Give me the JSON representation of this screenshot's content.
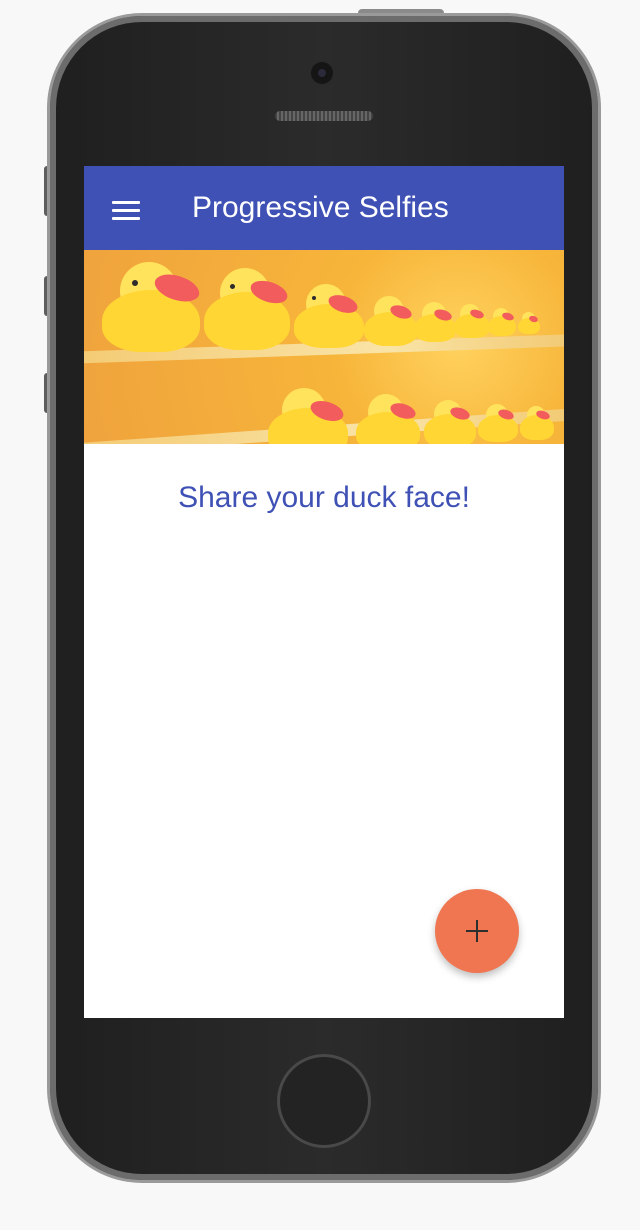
{
  "app": {
    "title": "Progressive Selfies",
    "headline": "Share your duck face!",
    "fab_symbol": "+",
    "colors": {
      "appbar": "#3f51b5",
      "headline": "#3f51b5",
      "fab": "#ef7651"
    }
  },
  "icons": {
    "menu": "hamburger-menu-icon",
    "add": "plus-icon"
  }
}
